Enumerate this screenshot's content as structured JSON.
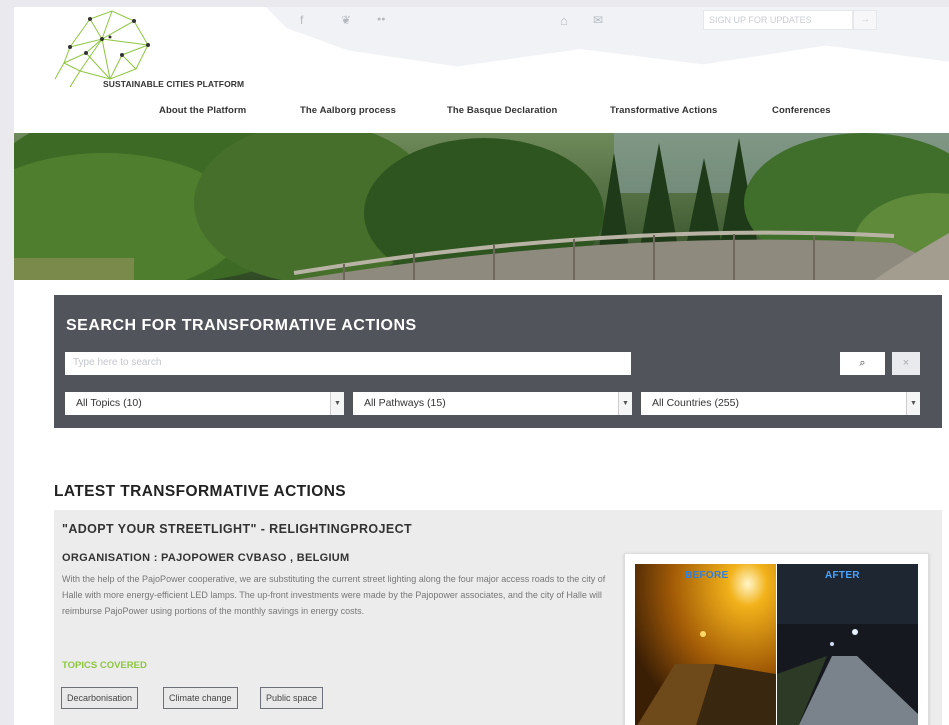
{
  "brand": {
    "title": "SUSTAINABLE CITIES PLATFORM"
  },
  "social": {
    "facebook": "f",
    "twitter": "❦",
    "flickr": "●●"
  },
  "topbar": {
    "home": "⌂",
    "mail": "✉",
    "signup_placeholder": "SIGN UP FOR UPDATES",
    "signup_submit": "→"
  },
  "nav": {
    "items": [
      "About the Platform",
      "The Aalborg process",
      "The Basque Declaration",
      "Transformative Actions",
      "Conferences"
    ]
  },
  "search": {
    "title": "SEARCH FOR TRANSFORMATIVE ACTIONS",
    "placeholder": "Type here to search",
    "search_icon": "⌕",
    "clear_icon": "×",
    "filters": {
      "topics": "All Topics (10)",
      "pathways": "All Pathways (15)",
      "countries": "All Countries (255)"
    }
  },
  "latest": {
    "heading": "LATEST TRANSFORMATIVE ACTIONS",
    "card": {
      "title": "\"ADOPT YOUR STREETLIGHT\" - RELIGHTINGPROJECT",
      "organisation": "ORGANISATION : PAJOPOWER CVBASO , BELGIUM",
      "description": "With the help of the PajoPower cooperative, we are substituting the current street lighting along the four major access roads to the city of Halle with more energy-efficient LED lamps. The up-front investments were made by the Pajopower associates, and the city of Halle will reimburse PajoPower using portions of the monthly savings in energy costs.",
      "topics_label": "TOPICS COVERED",
      "tags": [
        "Decarbonisation",
        "Climate change",
        "Public space"
      ],
      "photo_before": "BEFORE",
      "photo_after": "AFTER"
    }
  },
  "colors": {
    "accent_green": "#8dc63f",
    "search_panel": "#52545b",
    "card_bg": "#ececec"
  }
}
